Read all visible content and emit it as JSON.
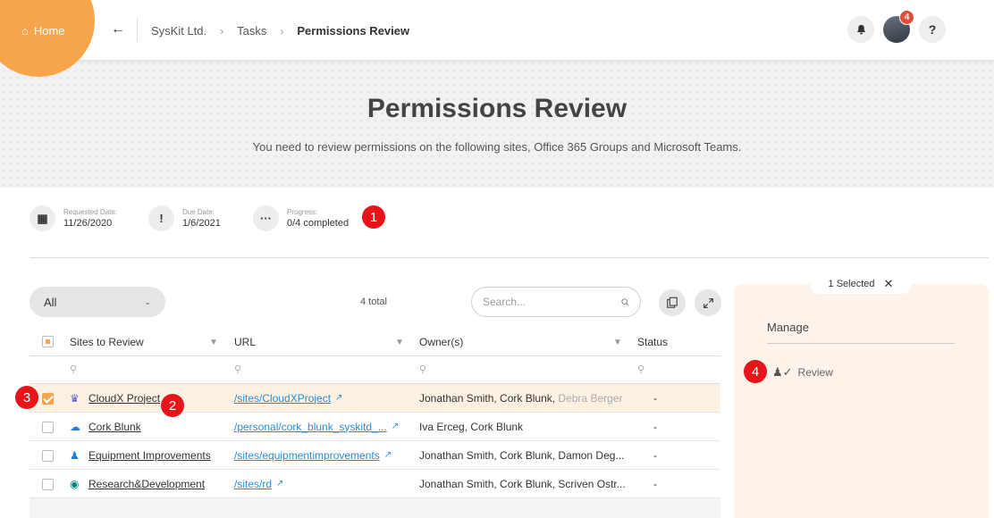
{
  "topbar": {
    "home_label": "Home",
    "breadcrumbs": [
      "SysKit Ltd.",
      "Tasks",
      "Permissions Review"
    ],
    "notifications_badge": "4",
    "help_label": "?"
  },
  "hero": {
    "title": "Permissions Review",
    "subtitle": "You need to review permissions on the following sites, Office 365 Groups and Microsoft Teams."
  },
  "info": {
    "requested": {
      "label": "Requested Date:",
      "value": "11/26/2020"
    },
    "due": {
      "label": "Due Date:",
      "value": "1/6/2021"
    },
    "progress": {
      "label": "Progress:",
      "value": "0/4 completed"
    }
  },
  "markers": [
    "1",
    "2",
    "3",
    "4"
  ],
  "toolbar": {
    "filter_value": "All",
    "total": "4 total",
    "search_placeholder": "Search..."
  },
  "table": {
    "columns": [
      "Sites to Review",
      "URL",
      "Owner(s)",
      "Status"
    ],
    "rows": [
      {
        "site": "CloudX Project",
        "icon": "teams-icon",
        "url": "/sites/CloudXProject",
        "owners": "Jonathan Smith, Cork Blunk,",
        "owners_extra": "Debra Berger",
        "status": "-",
        "checked": true
      },
      {
        "site": "Cork Blunk",
        "icon": "onedrive-icon",
        "url": "/personal/cork_blunk_syskitd_...",
        "owners": "Iva Erceg, Cork Blunk",
        "owners_extra": "",
        "status": "-",
        "checked": false
      },
      {
        "site": "Equipment Improvements",
        "icon": "group-icon",
        "url": "/sites/equipmentimprovements",
        "owners": "Jonathan Smith, Cork Blunk, Damon Deg...",
        "owners_extra": "",
        "status": "-",
        "checked": false
      },
      {
        "site": "Research&Development",
        "icon": "sharepoint-icon",
        "url": "/sites/rd",
        "owners": "Jonathan Smith, Cork Blunk, Scriven Ostr...",
        "owners_extra": "",
        "status": "-",
        "checked": false
      }
    ]
  },
  "panel": {
    "selected_label": "1 Selected",
    "manage_title": "Manage",
    "review_label": "Review"
  },
  "colors": {
    "accent": "#f7a54a",
    "marker": "#e8141a",
    "link": "#2a8bd1"
  }
}
